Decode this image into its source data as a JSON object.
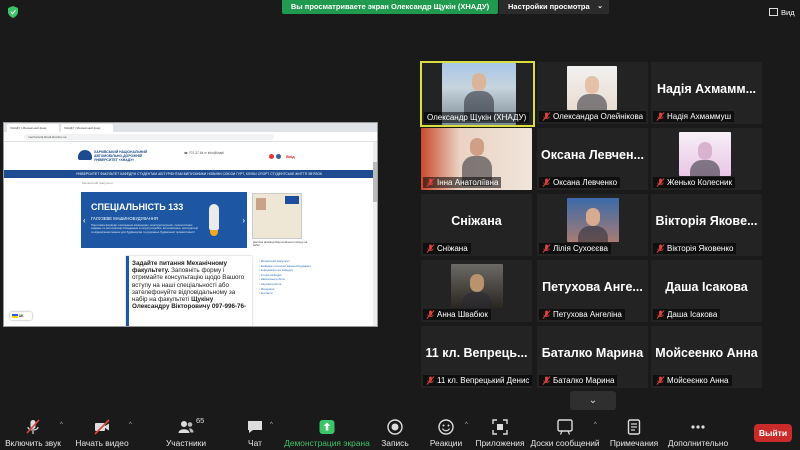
{
  "top_bar": {
    "sharing_banner": "Вы просматриваете экран Олександр Щукін (ХНАДУ)",
    "settings_label": "Настройки просмотра",
    "settings_chevron": "⌄",
    "view_label": "Вид"
  },
  "shared_screen": {
    "tabs": [
      "ХНАДУ | Механічний факу",
      "ХНАДУ | Механічний факу"
    ],
    "url": "mechanical.khadi.kharkov.ua",
    "logo_text": "ХАРКІВСЬКИЙ НАЦІОНАЛЬНИЙ АВТОМОБІЛЬНО-ДОРОЖНІЙ УНІВЕРСИТЕТ «ХНАДУ»",
    "header_info": "☎ 707-37-64    ✉ info@khadi",
    "enter_label": "Вхід",
    "nav_text": "УНІВЕРСИТЕТ  ФАКУЛЬТЕТ  КАФЕДРИ  СТУДЕНТАМ  АБІТУРІЄНТАМ  ВИПУСКНИКИ  НОВИНИ  СОЮЗИ ГУРТ, КЛУБИ  СПОРТ  СТУДЕНТСЬКЕ ЖИТТЯ  ЗВ'ЯЗОК",
    "breadcrumb": "Механічний факультет",
    "banner": {
      "title": "СПЕЦІАЛЬНІСТЬ 133",
      "subtitle": "ГАЛУЗЕВЕ МАШИНОБУДУВАННЯ",
      "text": "Підготовка фахівців з виконання інженерних, конструкторських, технологічних завдань та експлуатації обладнання в галузі розробки, виготовлення, експлуатації та відновлення машин для будівництва та дорожньо-будівельної промисловості",
      "arrow_left": "‹",
      "arrow_right": "›"
    },
    "doc_caption": "Диплом фахівця Європейського взірця на вибір",
    "side_links": [
      "Механічний факультет",
      "Кафедра технології машинобудування",
      "Інформація про кафедру",
      "Історія кафедри",
      "Навчальна робота",
      "Наукова робота",
      "Матеріали",
      "Контакти"
    ],
    "popup_title": "Задайте питання Механічному факультету.",
    "popup_text": " Заповніть форму і отримайте консультацію щодо Вашого вступу на наші спеціальності або зателефонуйте відповідальному за набір на факультеті ",
    "popup_contact": "Щукіну Олександру Вікторовичу 097-996-76-",
    "lang_label": "UK"
  },
  "participants": [
    {
      "display": "",
      "label": "Олександр Щукін (ХНАДУ)",
      "video": true,
      "active": true,
      "muted": false
    },
    {
      "display": "",
      "label": "Олександра Олейнікова",
      "video": true,
      "active": false,
      "muted": true
    },
    {
      "display": "Надія Ахмамм...",
      "label": "Надія Ахмаммуш",
      "video": false,
      "active": false,
      "muted": true
    },
    {
      "display": "",
      "label": "Інна Анатоліївна",
      "video": true,
      "active": false,
      "muted": true
    },
    {
      "display": "Оксана Левчен...",
      "label": "Оксана Левченко",
      "video": false,
      "active": false,
      "muted": true
    },
    {
      "display": "",
      "label": "Женько Колесник",
      "video": true,
      "active": false,
      "muted": true
    },
    {
      "display": "Сніжана",
      "label": "Сніжана",
      "video": false,
      "active": false,
      "muted": true
    },
    {
      "display": "",
      "label": "Лілія Сухоєєва",
      "video": true,
      "active": false,
      "muted": true
    },
    {
      "display": "Вікторія Яковe...",
      "label": "Вікторія Яковенко",
      "video": false,
      "active": false,
      "muted": true
    },
    {
      "display": "",
      "label": "Анна Швабюк",
      "video": true,
      "active": false,
      "muted": true
    },
    {
      "display": "Петухова Анге...",
      "label": "Петухова Ангеліна",
      "video": false,
      "active": false,
      "muted": true
    },
    {
      "display": "Даша Ісакова",
      "label": "Даша Ісакова",
      "video": false,
      "active": false,
      "muted": true
    },
    {
      "display": "11 кл. Вепрець...",
      "label": "11 кл. Вепрецький Денис",
      "video": false,
      "active": false,
      "muted": true
    },
    {
      "display": "Баталко Марина",
      "label": "Баталко Марина",
      "video": false,
      "active": false,
      "muted": true
    },
    {
      "display": "Мойсеенко Анна",
      "label": "Мойсеєнко Анна",
      "video": false,
      "active": false,
      "muted": true
    }
  ],
  "gallery_toggle": "⌄",
  "toolbar": {
    "mute": "Включить звук",
    "video": "Начать видео",
    "participants": "Участники",
    "participants_count": "65",
    "chat": "Чат",
    "share": "Демонстрация экрана",
    "record": "Запись",
    "reactions": "Реакции",
    "apps": "Приложения",
    "whiteboards": "Доски сообщений",
    "notes": "Примечания",
    "more": "Дополнительно",
    "leave": "Выйти",
    "caret": "^"
  },
  "colors": {
    "share_green": "#1f9a4e",
    "active_border": "#d9e03d",
    "leave_red": "#c92a2a",
    "muted_red": "#e0463a"
  }
}
